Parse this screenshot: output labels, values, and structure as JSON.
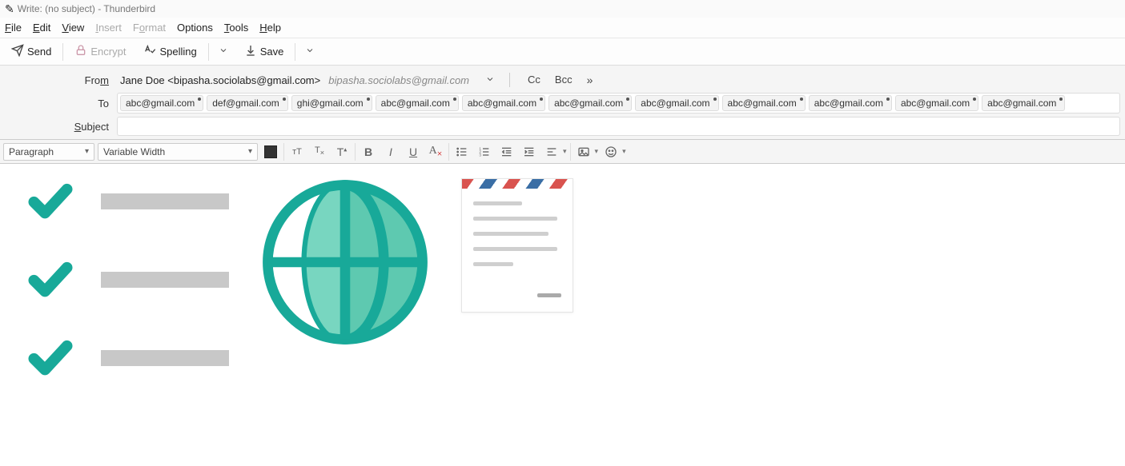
{
  "window": {
    "title": "Write: (no subject) - Thunderbird"
  },
  "menus": {
    "file": "File",
    "edit": "Edit",
    "view": "View",
    "insert": "Insert",
    "format": "Format",
    "options": "Options",
    "tools": "Tools",
    "help": "Help"
  },
  "toolbar": {
    "send": "Send",
    "encrypt": "Encrypt",
    "spelling": "Spelling",
    "save": "Save"
  },
  "from": {
    "label": "From",
    "value": "Jane Doe <bipasha.sociolabs@gmail.com>",
    "grey": "bipasha.sociolabs@gmail.com",
    "cc": "Cc",
    "bcc": "Bcc",
    "more": "»"
  },
  "to": {
    "label": "To",
    "recipients": [
      "abc@gmail.com",
      "def@gmail.com",
      "ghi@gmail.com",
      "abc@gmail.com",
      "abc@gmail.com",
      "abc@gmail.com",
      "abc@gmail.com",
      "abc@gmail.com",
      "abc@gmail.com",
      "abc@gmail.com",
      "abc@gmail.com"
    ]
  },
  "subject": {
    "label": "Subject",
    "value": ""
  },
  "format": {
    "para": "Paragraph",
    "font": "Variable Width"
  }
}
